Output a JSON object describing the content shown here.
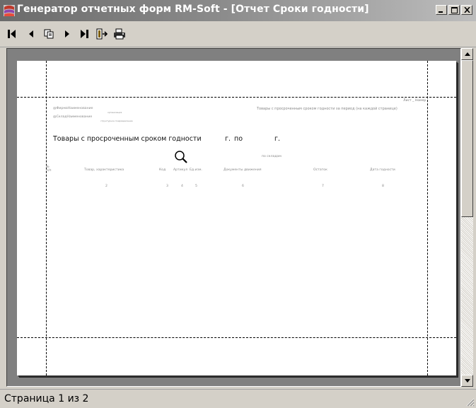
{
  "window": {
    "title": "Генератор отчетных форм RM-Soft - [Отчет Сроки годности]"
  },
  "toolbar": {
    "buttons": [
      "first-page-icon",
      "prev-page-icon",
      "copy-pages-icon",
      "next-page-icon",
      "last-page-icon",
      "exit-icon",
      "print-icon"
    ]
  },
  "report": {
    "top_right_label": "Лист _ Номер",
    "company_field": "@ФирмаНаименование",
    "company_sublabel": "организация",
    "warehouse_field": "@СкладНаименование",
    "warehouse_sublabel": "структурное подразделение",
    "subtitle": "Товары с просроченным сроком годности за период (на каждой странице)",
    "title": "Товары с просроченным сроком годности",
    "title_g": "г.",
    "title_po": "по",
    "title_g2": "г.",
    "by_warehouses": "по складам",
    "columns": {
      "num": "№\nп/п",
      "goods": "Товар, характеристика",
      "code": "Код",
      "article": "Артикул",
      "unit": "Ед.изм.",
      "docs": "Документы движения",
      "balance": "Остаток",
      "expiry": "Дата годности"
    },
    "col_numbers": [
      "2",
      "3",
      "4",
      "5",
      "6",
      "7",
      "8"
    ]
  },
  "status": {
    "text": "Страница 1 из 2"
  }
}
